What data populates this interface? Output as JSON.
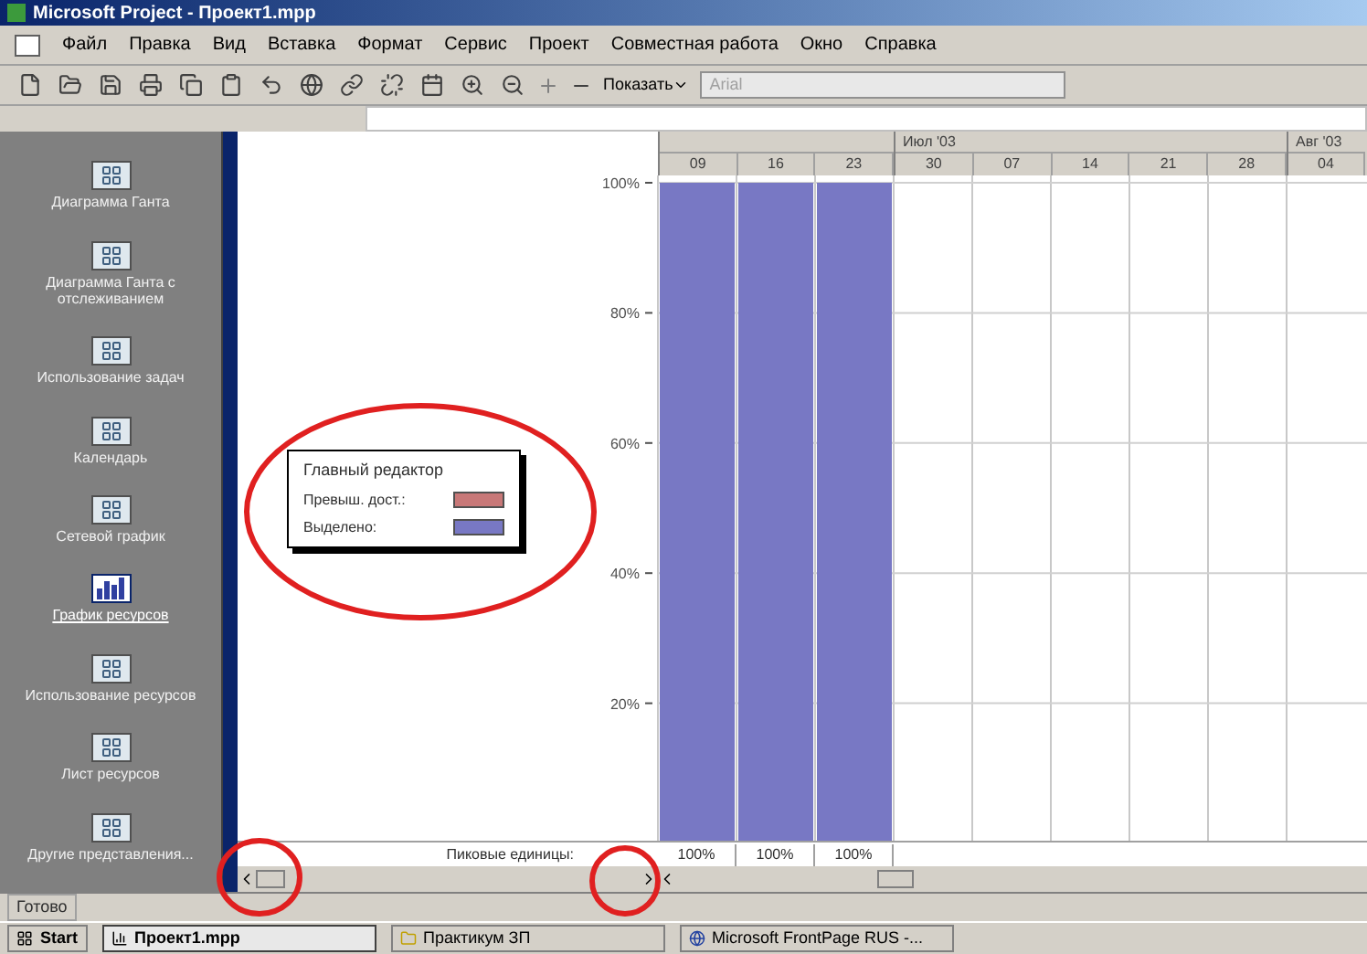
{
  "window": {
    "title": "Microsoft Project - Проект1.mpp"
  },
  "menu": [
    "Файл",
    "Правка",
    "Вид",
    "Вставка",
    "Формат",
    "Сервис",
    "Проект",
    "Совместная работа",
    "Окно",
    "Справка"
  ],
  "toolbar": {
    "show_label": "Показать",
    "font_field": "Arial"
  },
  "sidebar": {
    "items": [
      {
        "label": "Диаграмма Ганта",
        "selected": false
      },
      {
        "label": "Диаграмма Ганта с отслеживанием",
        "selected": false
      },
      {
        "label": "Использование задач",
        "selected": false
      },
      {
        "label": "Календарь",
        "selected": false
      },
      {
        "label": "Сетевой график",
        "selected": false
      },
      {
        "label": "График ресурсов",
        "selected": true
      },
      {
        "label": "Использование ресурсов",
        "selected": false
      },
      {
        "label": "Лист ресурсов",
        "selected": false
      },
      {
        "label": "Другие представления...",
        "selected": false
      }
    ]
  },
  "timescale": {
    "months": [
      {
        "weeks": [
          "09",
          "16",
          "23"
        ]
      },
      {
        "label": "Июл '03",
        "weeks": [
          "30",
          "07",
          "14",
          "21",
          "28"
        ]
      },
      {
        "label": "Авг '03",
        "weeks": [
          "04"
        ]
      }
    ]
  },
  "legend": {
    "title": "Главный редактор",
    "items": [
      {
        "label": "Превыш. дост.:",
        "color": "#c87878"
      },
      {
        "label": "Выделено:",
        "color": "#7878c4"
      }
    ]
  },
  "chart_data": {
    "type": "bar",
    "grid": true,
    "values": [
      100,
      100,
      100,
      0,
      0,
      0,
      0,
      0,
      0
    ],
    "ylim": [
      0,
      100
    ],
    "yticks": [
      {
        "value": 20,
        "label": "20%"
      },
      {
        "value": 40,
        "label": "40%"
      },
      {
        "value": 60,
        "label": "60%"
      },
      {
        "value": 80,
        "label": "80%"
      },
      {
        "value": 100,
        "label": "100%"
      }
    ]
  },
  "peak_units": {
    "label": "Пиковые единицы:",
    "values": [
      "100%",
      "100%",
      "100%"
    ]
  },
  "status_bar": {
    "text": "Готово"
  },
  "taskbar": {
    "start": "Start",
    "tasks": [
      "Проект1.mpp",
      "Практикум ЗП",
      "Microsoft FrontPage RUS -..."
    ]
  }
}
